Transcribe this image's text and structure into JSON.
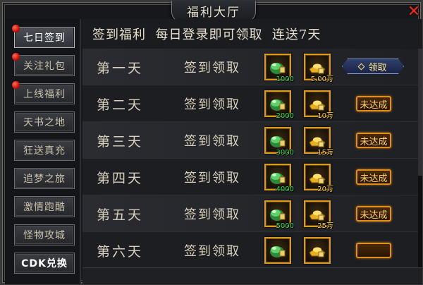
{
  "window": {
    "title": "福利大厅",
    "close_label": "✕"
  },
  "sidebar": {
    "items": [
      {
        "label": "七日签到",
        "active": true,
        "badge": true
      },
      {
        "label": "关注礼包",
        "active": false,
        "badge": true
      },
      {
        "label": "上线福利",
        "active": false,
        "badge": true
      },
      {
        "label": "天书之地",
        "active": false,
        "badge": false
      },
      {
        "label": "狂送真充",
        "active": false,
        "badge": false
      },
      {
        "label": "追梦之旅",
        "active": false,
        "badge": false
      },
      {
        "label": "激情跑酷",
        "active": false,
        "badge": false
      },
      {
        "label": "怪物攻城",
        "active": false,
        "badge": false
      },
      {
        "label": "CDK兑换",
        "active": false,
        "badge": false
      }
    ]
  },
  "header": {
    "title": "签到福利  每日登录即可领取  连送7天"
  },
  "rows": [
    {
      "day": "第一天",
      "sign": "签到领取",
      "item1": {
        "count": "1000",
        "icon": "green-jade-icon"
      },
      "item2": {
        "count": "5.00万",
        "icon": "gold-ingot-icon"
      },
      "status": "claim",
      "status_label": "领取"
    },
    {
      "day": "第二天",
      "sign": "签到领取",
      "item1": {
        "count": "2000",
        "icon": "green-jade-icon"
      },
      "item2": {
        "count": "10万",
        "icon": "gold-ingot-icon"
      },
      "status": "unmet",
      "status_label": "未达成"
    },
    {
      "day": "第三天",
      "sign": "签到领取",
      "item1": {
        "count": "3000",
        "icon": "green-jade-icon"
      },
      "item2": {
        "count": "15万",
        "icon": "gold-ingot-icon"
      },
      "status": "unmet",
      "status_label": "未达成"
    },
    {
      "day": "第四天",
      "sign": "签到领取",
      "item1": {
        "count": "4000",
        "icon": "green-jade-icon"
      },
      "item2": {
        "count": "20万",
        "icon": "gold-ingot-icon"
      },
      "status": "unmet",
      "status_label": "未达成"
    },
    {
      "day": "第五天",
      "sign": "签到领取",
      "item1": {
        "count": "5000",
        "icon": "green-jade-icon"
      },
      "item2": {
        "count": "25万",
        "icon": "gold-ingot-icon"
      },
      "status": "unmet",
      "status_label": "未达成"
    },
    {
      "day": "第六天",
      "sign": "签到领取",
      "item1": {
        "count": "",
        "icon": "green-jade-icon"
      },
      "item2": {
        "count": "",
        "icon": "gold-ingot-icon"
      },
      "status": "unmet",
      "status_label": ""
    }
  ],
  "colors": {
    "item1_count": "#2ee05a",
    "item2_count": "#ffd23a",
    "slot_border": "#d99a1e",
    "unmet_border": "#e0901a",
    "badge": "#d81810"
  }
}
